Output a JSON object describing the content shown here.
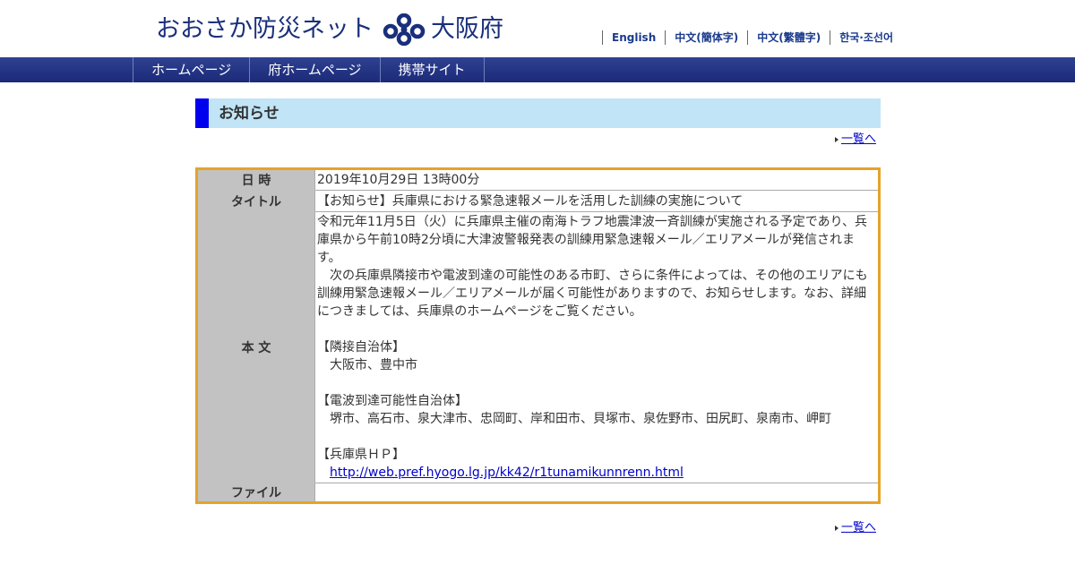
{
  "header": {
    "logo_text": "おおさか防災ネット",
    "logo_osaka": "大阪府"
  },
  "languages": [
    "English",
    "中文(簡体字)",
    "中文(繁體字)",
    "한국·조선어"
  ],
  "nav": [
    "ホームページ",
    "府ホームページ",
    "携帯サイト"
  ],
  "notice": {
    "heading": "お知らせ",
    "back_link": "一覧へ",
    "labels": {
      "date": "日 時",
      "title": "タイトル",
      "body": "本 文",
      "file": "ファイル"
    },
    "date": "2019年10月29日 13時00分",
    "title": "【お知らせ】兵庫県における緊急速報メールを活用した訓練の実施について",
    "body_para1": "令和元年11月5日（火）に兵庫県主催の南海トラフ地震津波一斉訓練が実施される予定であり、兵庫県から午前10時2分頃に大津波警報発表の訓練用緊急速報メール／エリアメールが発信されます。",
    "body_para2": "　次の兵庫県隣接市や電波到達の可能性のある市町、さらに条件によっては、その他のエリアにも訓練用緊急速報メール／エリアメールが届く可能性がありますので、お知らせします。なお、詳細につきましては、兵庫県のホームページをご覧ください。",
    "adjacent_heading": "【隣接自治体】",
    "adjacent_list": "大阪市、豊中市",
    "reach_heading": "【電波到達可能性自治体】",
    "reach_list": "堺市、高石市、泉大津市、忠岡町、岸和田市、貝塚市、泉佐野市、田尻町、泉南市、岬町",
    "hp_heading": "【兵庫県ＨＰ】",
    "hp_url": "http://web.pref.hyogo.lg.jp/kk42/r1tunamikunnrenn.html",
    "file": ""
  },
  "colors": {
    "nav_bg": "#1b2a78",
    "heading_bg": "#c1e4f6",
    "heading_bar": "#0000ee",
    "table_border": "#e5a32a",
    "label_bg": "#c2c2c2"
  }
}
